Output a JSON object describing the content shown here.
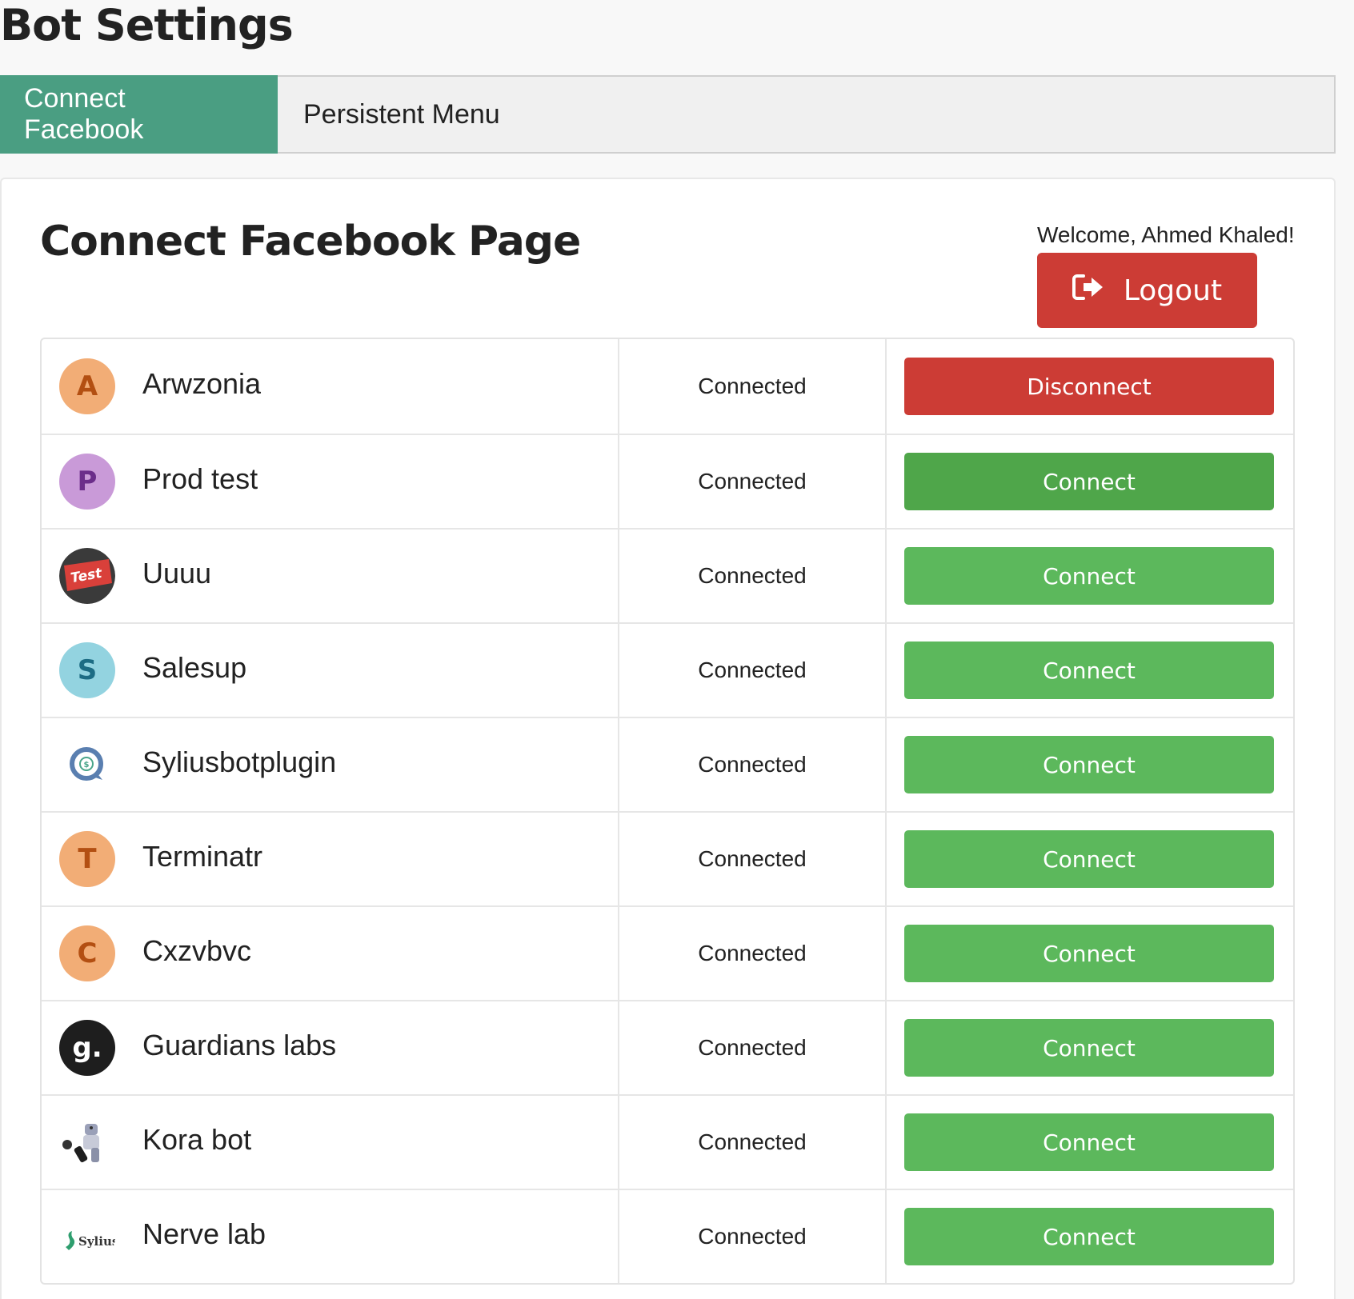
{
  "app": {
    "title": "Bot Settings"
  },
  "tabs": [
    {
      "label": "Connect Facebook",
      "active": true
    },
    {
      "label": "Persistent Menu",
      "active": false
    }
  ],
  "panel": {
    "title": "Connect Facebook Page",
    "welcome": "Welcome, Ahmed Khaled!",
    "logout_label": "Logout",
    "logout_icon": "sign-out-icon"
  },
  "colors": {
    "accent_tab": "#4a9e82",
    "danger": "#cc3c35",
    "success": "#5cb85c",
    "success_hover": "#4fa64a"
  },
  "pages": [
    {
      "name": "Arwzonia",
      "avatar_letter": "A",
      "avatar_bg": "#f2ad76",
      "avatar_fg": "#b34f12",
      "status": "Connected",
      "action": "Disconnect"
    },
    {
      "name": "Prod test",
      "avatar_letter": "P",
      "avatar_bg": "#c99ad8",
      "avatar_fg": "#6b2d8a",
      "status": "Connected",
      "action": "Connect"
    },
    {
      "name": "Uuuu",
      "avatar_letter": "",
      "avatar_image": "test-key-image",
      "status": "Connected",
      "action": "Connect"
    },
    {
      "name": "Salesup",
      "avatar_letter": "S",
      "avatar_bg": "#93d3e0",
      "avatar_fg": "#1d6c84",
      "status": "Connected",
      "action": "Connect"
    },
    {
      "name": "Syliusbotplugin",
      "avatar_letter": "",
      "avatar_image": "chat-bubble-logo",
      "status": "Connected",
      "action": "Connect"
    },
    {
      "name": "Terminatr",
      "avatar_letter": "T",
      "avatar_bg": "#f2ad76",
      "avatar_fg": "#b34f12",
      "status": "Connected",
      "action": "Connect"
    },
    {
      "name": "Cxzvbvc",
      "avatar_letter": "C",
      "avatar_bg": "#f2ad76",
      "avatar_fg": "#b34f12",
      "status": "Connected",
      "action": "Connect"
    },
    {
      "name": "Guardians labs",
      "avatar_letter": "g.",
      "avatar_bg": "#1e1e1e",
      "avatar_fg": "#ffffff",
      "status": "Connected",
      "action": "Connect"
    },
    {
      "name": "Kora bot",
      "avatar_letter": "",
      "avatar_image": "robot-soccer-image",
      "status": "Connected",
      "action": "Connect"
    },
    {
      "name": "Nerve lab",
      "avatar_letter": "",
      "avatar_image": "sylius-logo",
      "avatar_text": "Sylius",
      "status": "Connected",
      "action": "Connect"
    }
  ]
}
